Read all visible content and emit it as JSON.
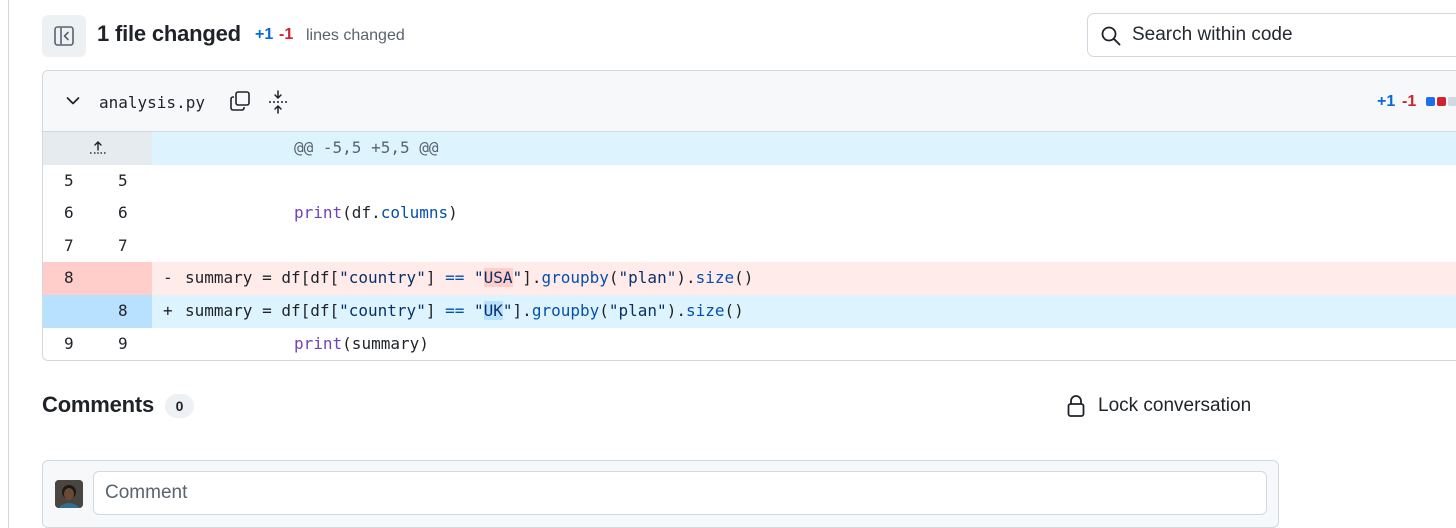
{
  "toolbar": {
    "files_changed": "1 file changed",
    "added": "+1",
    "removed": "-1",
    "lines_changed": "lines changed",
    "search_placeholder": "Search within code"
  },
  "file": {
    "name": "analysis.py",
    "added": "+1",
    "removed": "-1",
    "hunk_header": "@@ -5,5 +5,5 @@",
    "lines": [
      {
        "old": "5",
        "new": "5",
        "type": "context",
        "marker": "",
        "code": ""
      },
      {
        "old": "6",
        "new": "6",
        "type": "context",
        "marker": "",
        "code": "print(df.columns)"
      },
      {
        "old": "7",
        "new": "7",
        "type": "context",
        "marker": "",
        "code": ""
      },
      {
        "old": "8",
        "new": "",
        "type": "deletion",
        "marker": "-",
        "code": "summary = df[df[\"country\"] == \"USA\"].groupby(\"plan\").size()"
      },
      {
        "old": "",
        "new": "8",
        "type": "addition",
        "marker": "+",
        "code": "summary = df[df[\"country\"] == \"UK\"].groupby(\"plan\").size()"
      },
      {
        "old": "9",
        "new": "9",
        "type": "context",
        "marker": "",
        "code": "print(summary)"
      }
    ]
  },
  "comments": {
    "title": "Comments",
    "count": "0",
    "lock_label": "Lock conversation",
    "input_placeholder": "Comment"
  },
  "colors": {
    "added": "#0969da",
    "removed": "#cf222e",
    "deletion_bg": "#ffebe9",
    "addition_bg": "#ddf4ff"
  }
}
